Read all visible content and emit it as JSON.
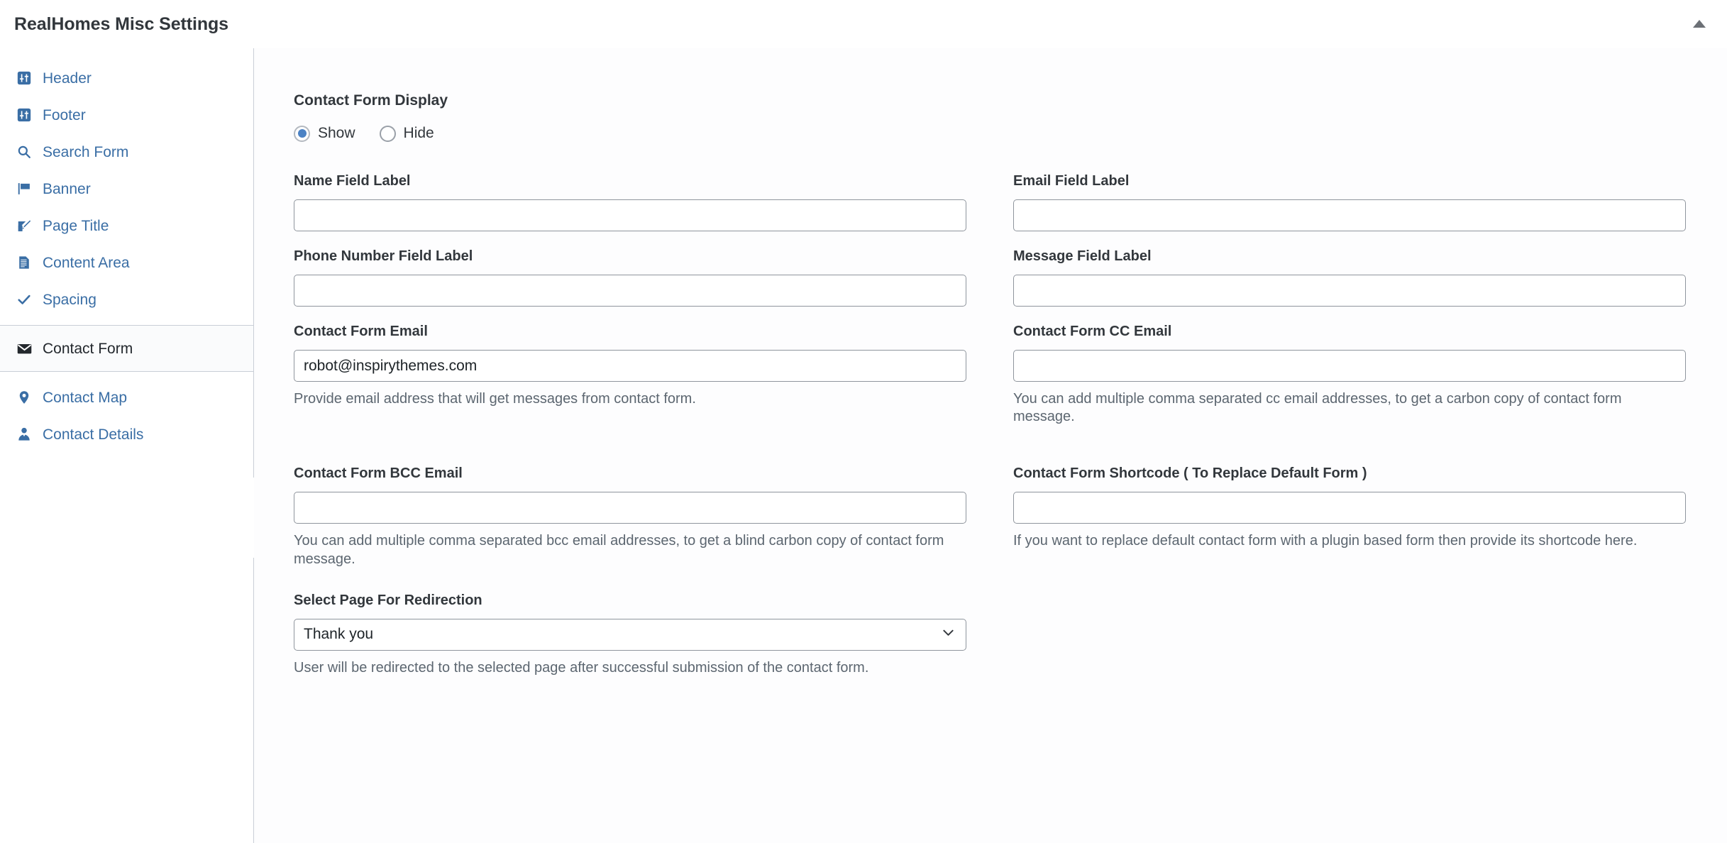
{
  "header": {
    "title": "RealHomes Misc Settings",
    "collapse_icon": "triangle-up-icon"
  },
  "sidebar": {
    "items": [
      {
        "label": "Header",
        "icon": "sliders-square-icon",
        "active": false
      },
      {
        "label": "Footer",
        "icon": "sliders-square-icon",
        "active": false
      },
      {
        "label": "Search Form",
        "icon": "search-icon",
        "active": false
      },
      {
        "label": "Banner",
        "icon": "flag-icon",
        "active": false
      },
      {
        "label": "Page Title",
        "icon": "edit-pencil-icon",
        "active": false
      },
      {
        "label": "Content Area",
        "icon": "document-icon",
        "active": false
      },
      {
        "label": "Spacing",
        "icon": "check-icon",
        "active": false
      },
      {
        "label": "Contact Form",
        "icon": "envelope-icon",
        "active": true
      },
      {
        "label": "Contact Map",
        "icon": "map-pin-icon",
        "active": false
      },
      {
        "label": "Contact Details",
        "icon": "user-tie-icon",
        "active": false
      }
    ]
  },
  "main": {
    "section_title": "Contact Form Display",
    "display_radio": {
      "options": [
        {
          "label": "Show",
          "checked": true
        },
        {
          "label": "Hide",
          "checked": false
        }
      ]
    },
    "fields": {
      "name_field_label": {
        "label": "Name Field Label",
        "value": "",
        "placeholder": "",
        "help": ""
      },
      "email_field_label": {
        "label": "Email Field Label",
        "value": "",
        "placeholder": "",
        "help": ""
      },
      "phone_field_label": {
        "label": "Phone Number Field Label",
        "value": "",
        "placeholder": "",
        "help": ""
      },
      "message_field_label": {
        "label": "Message Field Label",
        "value": "",
        "placeholder": "",
        "help": ""
      },
      "contact_form_email": {
        "label": "Contact Form Email",
        "value": "robot@inspirythemes.com",
        "placeholder": "",
        "help": "Provide email address that will get messages from contact form."
      },
      "contact_form_cc_email": {
        "label": "Contact Form CC Email",
        "value": "",
        "placeholder": "",
        "help": "You can add multiple comma separated cc email addresses, to get a carbon copy of contact form message."
      },
      "contact_form_bcc_email": {
        "label": "Contact Form BCC Email",
        "value": "",
        "placeholder": "",
        "help": "You can add multiple comma separated bcc email addresses, to get a blind carbon copy of contact form message."
      },
      "contact_form_shortcode": {
        "label": "Contact Form Shortcode ( To Replace Default Form )",
        "value": "",
        "placeholder": "",
        "help": "If you want to replace default contact form with a plugin based form then provide its shortcode here."
      },
      "redirection_page": {
        "label": "Select Page For Redirection",
        "value": "Thank you",
        "help": "User will be redirected to the selected page after successful submission of the contact form.",
        "chevron_icon": "chevron-down-icon"
      }
    }
  },
  "colors": {
    "link_blue": "#3a6ea5",
    "radio_fill": "#4b82c4",
    "text_dark": "#32373c",
    "help_gray": "#5c6670",
    "border_gray": "#8f959d",
    "divider_gray": "#c9ced6",
    "active_bg": "#fafbfc"
  }
}
